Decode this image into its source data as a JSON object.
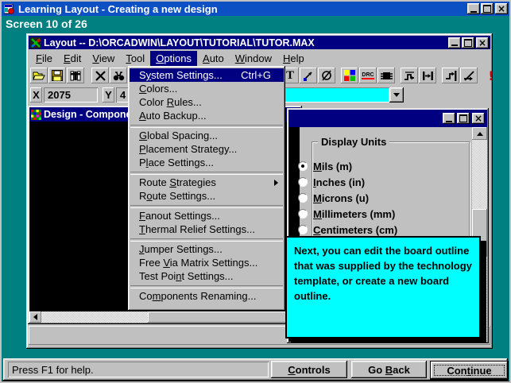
{
  "colors": {
    "desktop": "#008080",
    "app_titlebar": "#0c50c4",
    "window_titlebar": "#000080",
    "chrome": "#c0c0c0",
    "menu_highlight": "#000080",
    "tooltip_bg": "#00ffff",
    "combo_bg": "#00ffff",
    "drc_underline": "#ff0000",
    "error_marker": "#cc0000"
  },
  "app": {
    "title": "Learning Layout - Creating a new design",
    "screen_label": "Screen 10 of 26"
  },
  "layout_window": {
    "title": "Layout -- D:\\ORCADWIN\\LAYOUT\\TUTORIAL\\TUTOR.MAX",
    "menu_bar": [
      {
        "label": "&File"
      },
      {
        "label": "&Edit"
      },
      {
        "label": "&View"
      },
      {
        "label": "&Tool"
      },
      {
        "label": "&Options",
        "active": true
      },
      {
        "label": "&Auto"
      },
      {
        "label": "&Window"
      },
      {
        "label": "&Help"
      }
    ],
    "toolbar": {
      "icons": [
        "open-file",
        "save",
        "library-manager",
        "delete",
        "find",
        "text-tool",
        "dimension",
        "obstacle",
        "color-settings",
        "online-drc",
        "component-tool",
        "refresh-route",
        "shove-track",
        "end-route",
        "cancel-route",
        "error-marker"
      ],
      "x_label": "X",
      "x_value": "2075",
      "y_label": "Y",
      "y_value": "4",
      "combo_value": ""
    }
  },
  "design_window": {
    "title": "Design - Compone"
  },
  "options_menu": {
    "items": [
      {
        "label": "S&ystem Settings...",
        "shortcut": "Ctrl+G",
        "highlighted": true
      },
      {
        "label": "&Colors..."
      },
      {
        "label": "Color &Rules..."
      },
      {
        "label": "&Auto Backup..."
      },
      {
        "label": "&Global Spacing..."
      },
      {
        "label": "&Placement Strategy..."
      },
      {
        "label": "P&lace Settings..."
      },
      {
        "label": "Route &Strategies",
        "submenu": true
      },
      {
        "label": "R&oute Settings..."
      },
      {
        "label": "&Fanout Settings..."
      },
      {
        "label": "&Thermal Relief Settings..."
      },
      {
        "label": "&Jumper Settings..."
      },
      {
        "label": "Free &Via Matrix Settings..."
      },
      {
        "label": "Test Poi&nt Settings..."
      },
      {
        "label": "Co&mponents Renaming..."
      }
    ]
  },
  "dialog": {
    "group_title": "Display Units",
    "options": [
      {
        "label": "&Mils (m)",
        "selected": true
      },
      {
        "label": "&Inches (in)",
        "selected": false
      },
      {
        "label": "&Microns (u)",
        "selected": false
      },
      {
        "label": "&Millimeters (mm)",
        "selected": false
      },
      {
        "label": "&Centimeters (cm)",
        "selected": false
      }
    ]
  },
  "tooltip": {
    "text": "Next, you can edit the board outline that was supplied by the technology template, or create a new board outline."
  },
  "statusbar": {
    "message": "Press F1 for help.",
    "buttons": [
      {
        "label": "&Controls"
      },
      {
        "label": "Go &Back"
      },
      {
        "label": "Con&tinue",
        "default": true
      }
    ]
  }
}
